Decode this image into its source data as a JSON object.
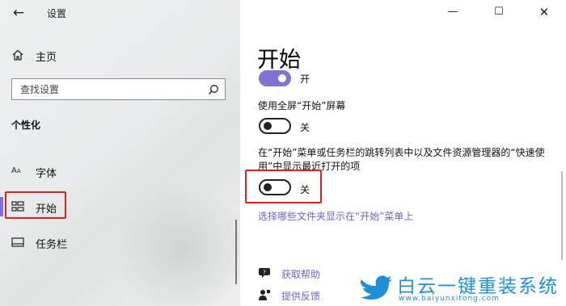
{
  "window": {
    "app_title": "设置",
    "back_icon": "back-arrow-icon",
    "controls": {
      "minimize": "—",
      "maximize": "☐",
      "close": "✕"
    }
  },
  "sidebar": {
    "home_label": "主页",
    "search_placeholder": "查找设置",
    "section_title": "个性化",
    "items": [
      {
        "label": "字体",
        "icon": "font-icon",
        "selected": false
      },
      {
        "label": "开始",
        "icon": "start-icon",
        "selected": true
      },
      {
        "label": "任务栏",
        "icon": "taskbar-icon",
        "selected": false
      }
    ],
    "font_icon_text": "A",
    "accent_color": "#7f73d6"
  },
  "main": {
    "page_title": "开始",
    "settings": [
      {
        "label": "",
        "state": "开",
        "on": true
      },
      {
        "label": "使用全屏“开始”屏幕",
        "state": "关",
        "on": false
      },
      {
        "label": "在“开始”菜单或任务栏的跳转列表中以及文件资源管理器的“快速使用”中显示最近打开的项",
        "state": "关",
        "on": false
      }
    ],
    "link": "选择哪些文件夹显示在“开始”菜单上",
    "help": [
      {
        "label": "获取帮助",
        "icon": "help-chat-icon"
      },
      {
        "label": "提供反馈",
        "icon": "feedback-icon"
      }
    ],
    "link_color": "#7361c9",
    "highlight_color": "#e02020"
  },
  "watermark": {
    "title": "白云一键重装系统",
    "url": "www.baiyunxitong.com",
    "color": "#1e90d8"
  }
}
